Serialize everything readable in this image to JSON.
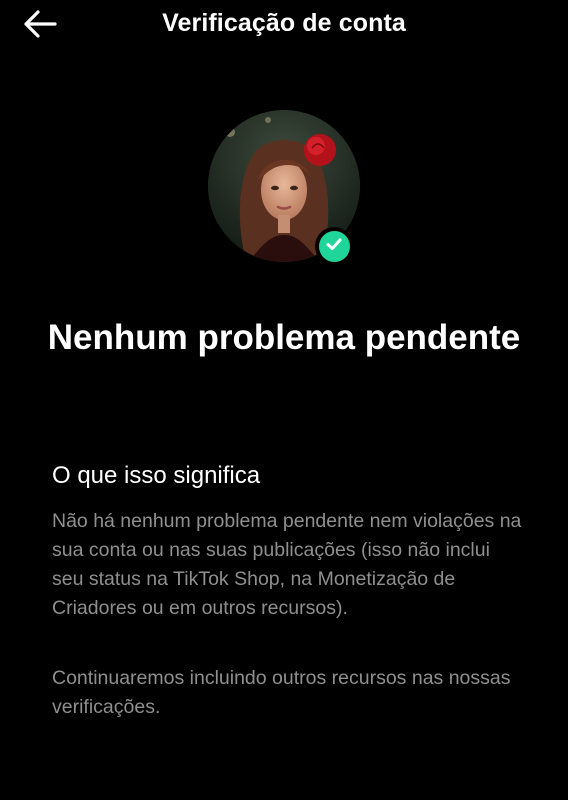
{
  "header": {
    "back_icon": "arrow-left-icon",
    "title": "Verificação de conta"
  },
  "profile": {
    "avatar_alt": "Foto de perfil",
    "badge_icon": "check-circle-icon",
    "badge_color": "#20d59a"
  },
  "status": {
    "headline": "Nenhum problema pendente"
  },
  "meaning": {
    "title": "O que isso significa",
    "paragraph_1": "Não há nenhum problema pendente nem violações na sua conta ou nas suas publicações (isso não inclui seu status na TikTok Shop, na Monetização de Criadores ou em outros recursos).",
    "paragraph_2": "Continuaremos incluindo outros recursos nas nossas verificações."
  }
}
